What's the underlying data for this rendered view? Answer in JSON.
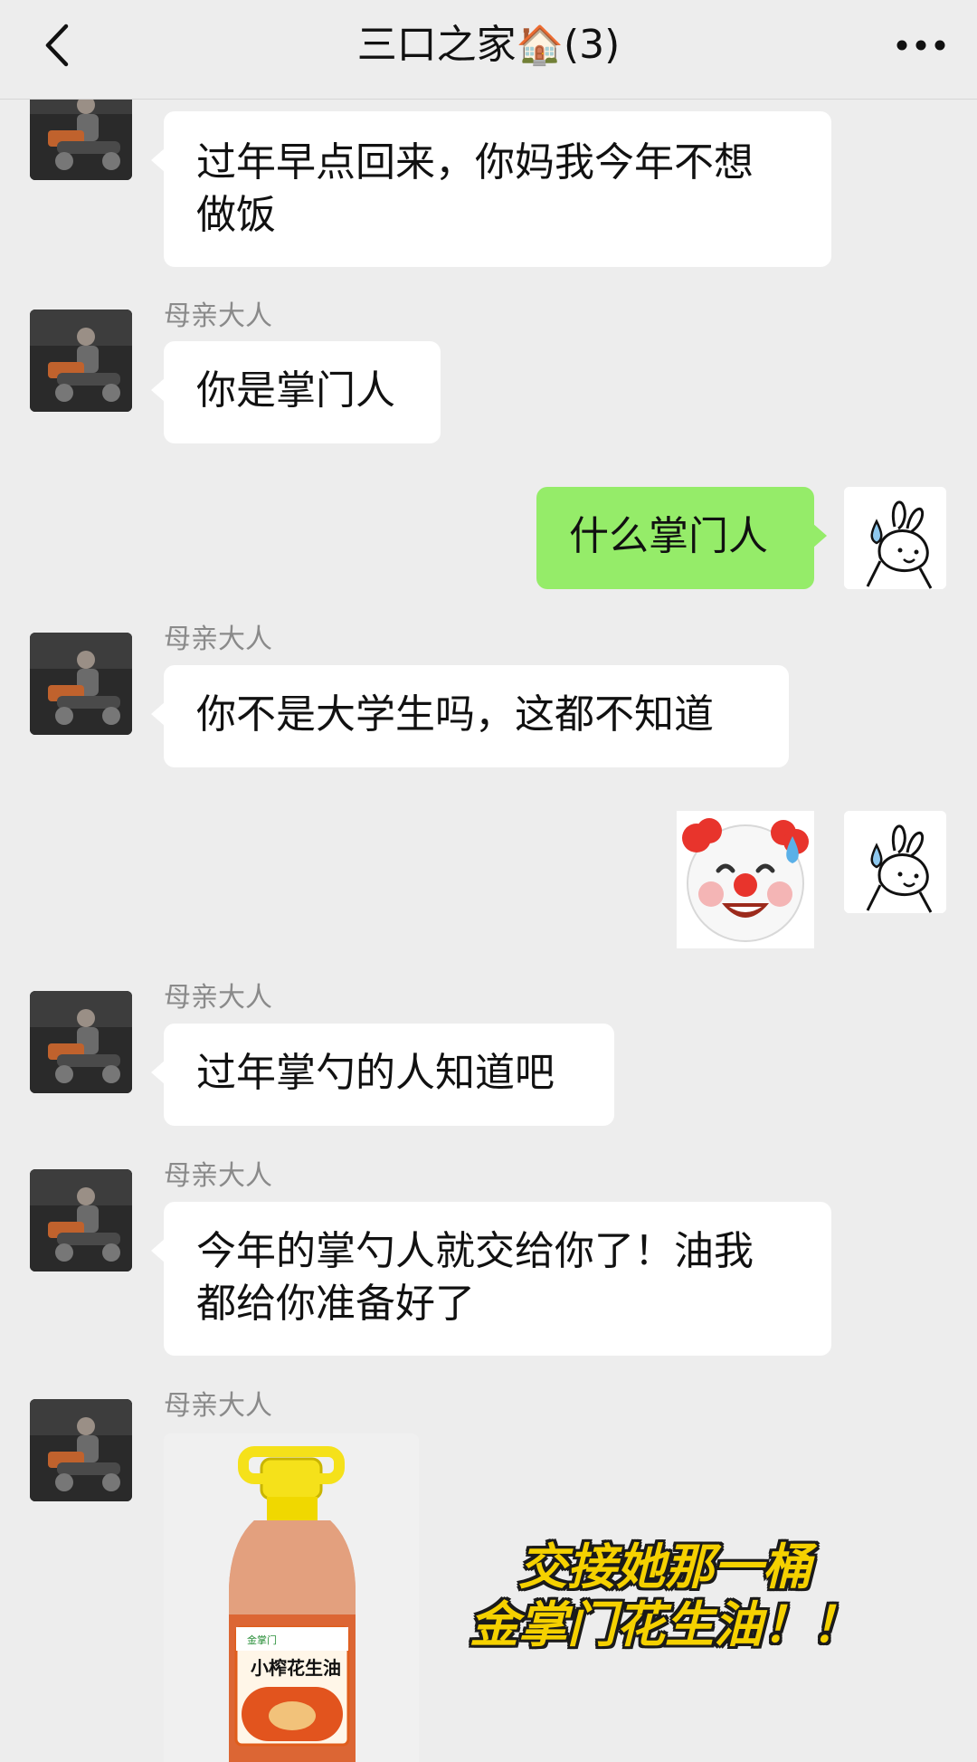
{
  "header": {
    "title": "三口之家",
    "title_emoji": "🏠",
    "member_count": "(3)",
    "back_icon": "chevron-left-icon",
    "more_icon": "more-dots-icon"
  },
  "messages": [
    {
      "from": "mom",
      "sender": "",
      "text_lines": [
        "过年早点回来，你妈我今年不想",
        "做饭"
      ]
    },
    {
      "from": "mom",
      "sender": "母亲大人",
      "text": "你是掌门人"
    },
    {
      "from": "me",
      "text": "什么掌门人"
    },
    {
      "from": "mom",
      "sender": "母亲大人",
      "text": "你不是大学生吗，这都不知道"
    },
    {
      "from": "me",
      "type": "sticker",
      "sticker": "clown-sweat-emoji"
    },
    {
      "from": "mom",
      "sender": "母亲大人",
      "text": "过年掌勺的人知道吧"
    },
    {
      "from": "mom",
      "sender": "母亲大人",
      "text_lines": [
        "今年的掌勺人就交给你了！油我",
        "都给你准备好了"
      ]
    },
    {
      "from": "mom",
      "sender": "母亲大人",
      "type": "image",
      "product": {
        "brand_text": "金掌门",
        "label": "小榨花生油"
      }
    }
  ],
  "caption_lines": [
    "交接她那一桶",
    "金掌门花生油！！"
  ],
  "colors": {
    "background": "#ededed",
    "my_bubble": "#95ec69",
    "other_bubble": "#ffffff",
    "caption": "#f5d100"
  }
}
